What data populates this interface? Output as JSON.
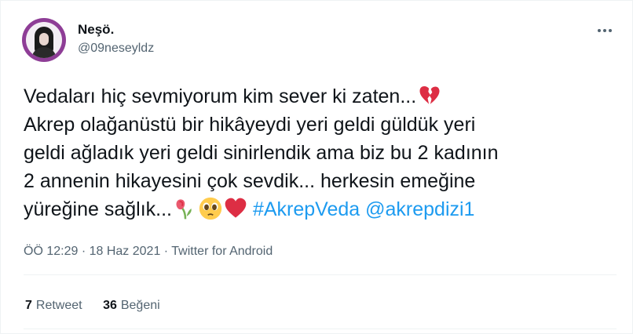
{
  "user": {
    "display_name": "Neşö.",
    "handle": "@09neseyldz"
  },
  "tweet": {
    "text_main": "Vedaları hiç sevmiyorum kim sever ki zaten...",
    "text_body": "Akrep olağanüstü bir hikâyeydi yeri geldi güldük yeri\ngeldi ağladık yeri geldi sinirlendik ama biz bu 2 kadının\n2 annenin hikayesini çok sevdik... herkesin emeğine",
    "text_last": "yüreğine sağlık...",
    "hashtag": "#AkrepVeda",
    "mention": "@akrepdizi1",
    "emojis": [
      "broken-heart-icon",
      "wilted-flower-icon",
      "pleading-face-icon",
      "red-heart-icon"
    ]
  },
  "meta": {
    "time": "ÖÖ 12:29",
    "separator": "·",
    "date": "18 Haz 2021",
    "source": "Twitter for Android"
  },
  "stats": {
    "retweet_count": "7",
    "retweet_label": "Retweet",
    "like_count": "36",
    "like_label": "Beğeni"
  },
  "colors": {
    "link": "#1d9bf0",
    "secondary_text": "#536471",
    "primary_text": "#0f1419"
  }
}
